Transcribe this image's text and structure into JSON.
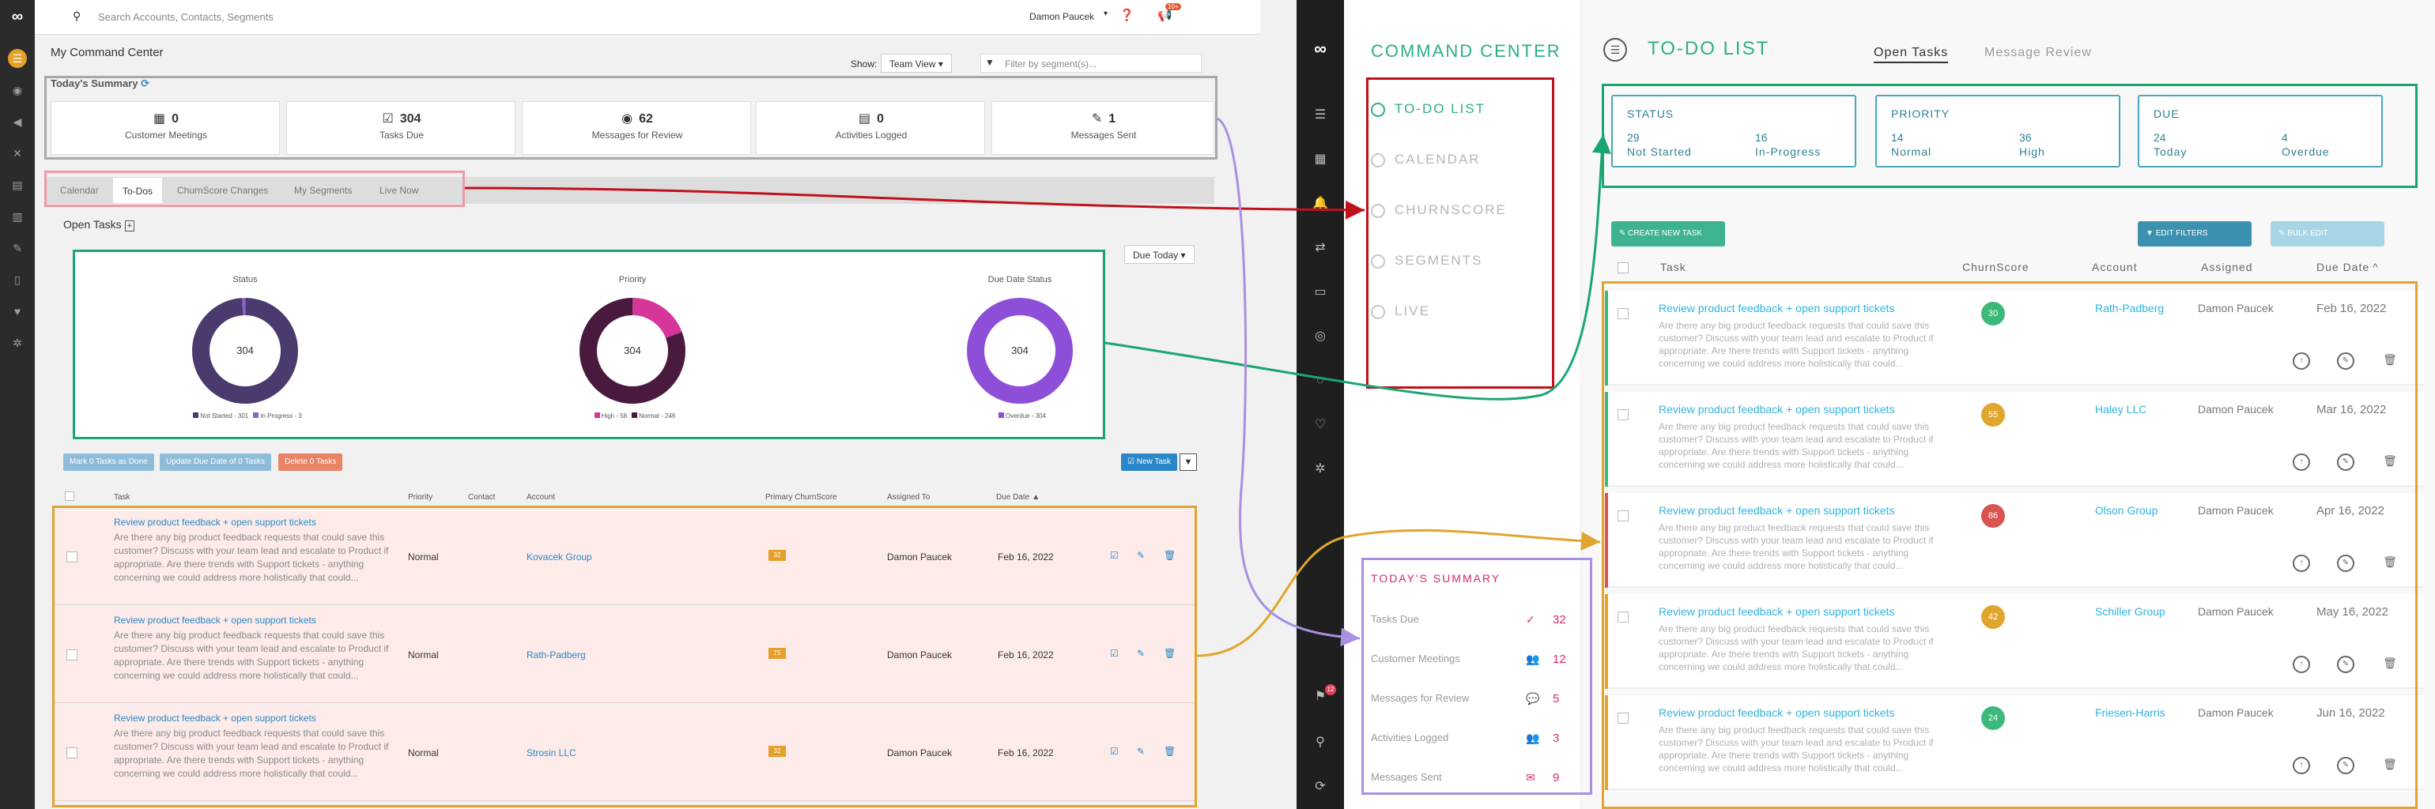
{
  "left_app": {
    "search_placeholder": "Search Accounts, Contacts, Segments",
    "user_menu": "Damon Paucek",
    "notification_badge": "10+",
    "page_title": "My Command Center",
    "show_label": "Show:",
    "view_select": "Team View",
    "segment_filter_placeholder": "Filter by segment(s)...",
    "summary": {
      "title": "Today's Summary",
      "items": [
        {
          "value": "0",
          "label": "Customer Meetings",
          "icon": "calendar-icon"
        },
        {
          "value": "304",
          "label": "Tasks Due",
          "icon": "checkbox-icon"
        },
        {
          "value": "62",
          "label": "Messages for Review",
          "icon": "eye-icon"
        },
        {
          "value": "0",
          "label": "Activities Logged",
          "icon": "list-icon"
        },
        {
          "value": "1",
          "label": "Messages Sent",
          "icon": "pencil-icon"
        }
      ]
    },
    "tabs": [
      "Calendar",
      "To-Dos",
      "ChurnScore Changes",
      "My Segments",
      "Live Now"
    ],
    "open_tasks_title": "Open Tasks",
    "due_filter": "Due Today",
    "charts": [
      {
        "title": "Status",
        "center": "304",
        "legend": [
          "Not Started - 301",
          "In Progress - 3"
        ],
        "colors": [
          "#4a3a6e",
          "#8d63c9"
        ]
      },
      {
        "title": "Priority",
        "center": "304",
        "legend": [
          "High - 58",
          "Normal - 246"
        ],
        "colors": [
          "#d6359a",
          "#4a1a3e"
        ]
      },
      {
        "title": "Due Date Status",
        "center": "304",
        "legend": [
          "Overdue - 304"
        ],
        "colors": [
          "#8d4fd8"
        ]
      }
    ],
    "bulk_buttons": [
      "Mark 0 Tasks as Done",
      "Update Due Date of 0 Tasks",
      "Delete 0 Tasks"
    ],
    "new_task": "New Task",
    "table_headers": [
      "Task",
      "Priority",
      "Contact",
      "Account",
      "Primary ChurnScore",
      "Assigned To",
      "Due Date"
    ],
    "rows": [
      {
        "title": "Review product feedback + open support tickets",
        "desc": "Are there any big product feedback requests that could save this customer? Discuss with your team lead and escalate to Product if appropriate. Are there trends with Support tickets - anything concerning we could address more holistically that could...",
        "priority": "Normal",
        "account": "Kovacek Group",
        "score": "32",
        "assigned": "Damon Paucek",
        "due": "Feb 16, 2022"
      },
      {
        "title": "Review product feedback + open support tickets",
        "desc": "Are there any big product feedback requests that could save this customer? Discuss with your team lead and escalate to Product if appropriate. Are there trends with Support tickets - anything concerning we could address more holistically that could...",
        "priority": "Normal",
        "account": "Rath-Padberg",
        "score": "75",
        "assigned": "Damon Paucek",
        "due": "Feb 16, 2022"
      },
      {
        "title": "Review product feedback + open support tickets",
        "desc": "Are there any big product feedback requests that could save this customer? Discuss with your team lead and escalate to Product if appropriate. Are there trends with Support tickets - anything concerning we could address more holistically that could...",
        "priority": "Normal",
        "account": "Strosin LLC",
        "score": "32",
        "assigned": "Damon Paucek",
        "due": "Feb 16, 2022"
      }
    ]
  },
  "right_app": {
    "section_title": "COMMAND CENTER",
    "nav": [
      "TO-DO LIST",
      "CALENDAR",
      "CHURNSCORE",
      "SEGMENTS",
      "LIVE"
    ],
    "sidebar_badge": "12",
    "today_summary": {
      "title": "TODAY'S SUMMARY",
      "items": [
        {
          "label": "Tasks Due",
          "value": "32"
        },
        {
          "label": "Customer Meetings",
          "value": "12"
        },
        {
          "label": "Messages for Review",
          "value": "5"
        },
        {
          "label": "Activities Logged",
          "value": "3"
        },
        {
          "label": "Messages Sent",
          "value": "9"
        }
      ]
    },
    "page_title": "TO-DO LIST",
    "tabs": [
      "Open Tasks",
      "Message Review"
    ],
    "stats": [
      {
        "head": "STATUS",
        "a_val": "29",
        "a_lbl": "Not Started",
        "b_val": "16",
        "b_lbl": "In-Progress"
      },
      {
        "head": "PRIORITY",
        "a_val": "14",
        "a_lbl": "Normal",
        "b_val": "36",
        "b_lbl": "High"
      },
      {
        "head": "DUE",
        "a_val": "24",
        "a_lbl": "Today",
        "b_val": "4",
        "b_lbl": "Overdue"
      }
    ],
    "create_task": "CREATE NEW TASK",
    "edit_filters": "EDIT FILTERS",
    "bulk_edit": "BULK EDIT",
    "headers": [
      "Task",
      "ChurnScore",
      "Account",
      "Assigned",
      "Due Date"
    ],
    "rows": [
      {
        "title": "Review product feedback + open support tickets",
        "desc": "Are there any big product feedback requests that could save this customer? Discuss with your team lead and escalate to Product if appropriate. Are there trends with Support tickets - anything concerning we could address more holistically that could...",
        "score": "30",
        "score_color": "#3ab97a",
        "bar": "#3ab97a",
        "account": "Rath-Padberg",
        "assigned": "Damon Paucek",
        "due": "Feb 16, 2022"
      },
      {
        "title": "Review product feedback + open support tickets",
        "desc": "Are there any big product feedback requests that could save this customer? Discuss with your team lead and escalate to Product if appropriate. Are there trends with Support tickets - anything concerning we could address more holistically that could...",
        "score": "55",
        "score_color": "#e0a52c",
        "bar": "#3ab97a",
        "account": "Haley LLC",
        "assigned": "Damon Paucek",
        "due": "Mar 16, 2022"
      },
      {
        "title": "Review product feedback + open support tickets",
        "desc": "Are there any big product feedback requests that could save this customer? Discuss with your team lead and escalate to Product if appropriate. Are there trends with Support tickets - anything concerning we could address more holistically that could...",
        "score": "86",
        "score_color": "#d9534f",
        "bar": "#d9534f",
        "account": "Olson Group",
        "assigned": "Damon Paucek",
        "due": "Apr 16, 2022"
      },
      {
        "title": "Review product feedback + open support tickets",
        "desc": "Are there any big product feedback requests that could save this customer? Discuss with your team lead and escalate to Product if appropriate. Are there trends with Support tickets - anything concerning we could address more holistically that could...",
        "score": "42",
        "score_color": "#e0a52c",
        "bar": "#e0a52c",
        "account": "Schiller Group",
        "assigned": "Damon Paucek",
        "due": "May 16, 2022"
      },
      {
        "title": "Review product feedback + open support tickets",
        "desc": "Are there any big product feedback requests that could save this customer? Discuss with your team lead and escalate to Product if appropriate. Are there trends with Support tickets - anything concerning we could address more holistically that could...",
        "score": "24",
        "score_color": "#3ab97a",
        "bar": "#e0a52c",
        "account": "Friesen-Harris",
        "assigned": "Damon Paucek",
        "due": "Jun 16, 2022"
      }
    ]
  },
  "colors": {
    "red": "#c0111a",
    "green": "#1aa572",
    "orange": "#e0a52c",
    "purple": "#a990e0",
    "pink": "#ee9aa6",
    "gray": "#a8a8a8"
  }
}
